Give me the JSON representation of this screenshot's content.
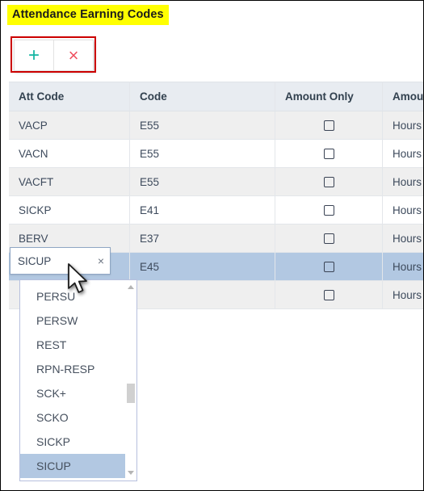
{
  "page": {
    "title": "Attendance Earning Codes",
    "title_highlight_color": "#ffff00"
  },
  "toolbar": {
    "annotation_color": "#cc0000",
    "add_label": "+",
    "add_icon": "plus-icon",
    "add_color": "#13b5a2",
    "delete_label": "×",
    "delete_icon": "close-x-icon",
    "delete_color": "#ef5160"
  },
  "table": {
    "columns": [
      {
        "key": "att_code",
        "label": "Att Code"
      },
      {
        "key": "code",
        "label": "Code"
      },
      {
        "key": "amount_only",
        "label": "Amount Only"
      },
      {
        "key": "amount_as",
        "label": "AmountAs"
      }
    ],
    "header_bg": "#e8ecf1",
    "selected_row_bg": "#b2c8e2",
    "alt_row_bg": "#efefef",
    "rows": [
      {
        "att_code": "VACP",
        "code": "E55",
        "amount_only": false,
        "amount_as": "Hours x Rate",
        "selected": false
      },
      {
        "att_code": "VACN",
        "code": "E55",
        "amount_only": false,
        "amount_as": "Hours x Rate",
        "selected": false
      },
      {
        "att_code": "VACFT",
        "code": "E55",
        "amount_only": false,
        "amount_as": "Hours x Rate",
        "selected": false
      },
      {
        "att_code": "SICKP",
        "code": "E41",
        "amount_only": false,
        "amount_as": "Hours x Rate",
        "selected": false
      },
      {
        "att_code": "BERV",
        "code": "E37",
        "amount_only": false,
        "amount_as": "Hours x Rate",
        "selected": false
      },
      {
        "att_code": "SICUP",
        "code": "E45",
        "amount_only": false,
        "amount_as": "Hours x Rate",
        "selected": true
      },
      {
        "att_code": "",
        "code": "",
        "amount_only": false,
        "amount_as": "Hours x Rate",
        "selected": false
      }
    ]
  },
  "cell_editor": {
    "value": "SICUP",
    "clear_label": "×",
    "clear_icon": "clear-x-icon"
  },
  "dropdown": {
    "items": [
      {
        "label": "PERSU",
        "selected": false
      },
      {
        "label": "PERSW",
        "selected": false
      },
      {
        "label": "REST",
        "selected": false
      },
      {
        "label": "RPN-RESP",
        "selected": false
      },
      {
        "label": "SCK+",
        "selected": false
      },
      {
        "label": "SCKO",
        "selected": false
      },
      {
        "label": "SICKP",
        "selected": false
      },
      {
        "label": "SICUP",
        "selected": true
      }
    ],
    "selected_bg": "#b2c8e2"
  }
}
